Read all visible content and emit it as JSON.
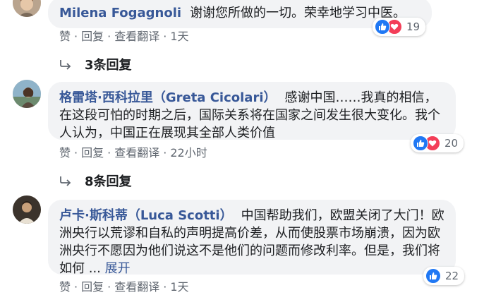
{
  "labels": {
    "like": "赞",
    "reply": "回复",
    "translate": "查看翻译",
    "separator": "·",
    "see_more": "展开"
  },
  "comments": [
    {
      "author": "Milena Fogagnoli",
      "text": "谢谢您所做的一切。荣幸地学习中医。",
      "time": "1天",
      "reactions": {
        "count": "19",
        "types": [
          "like-icon",
          "love-icon"
        ]
      },
      "replies_label": "3条回复"
    },
    {
      "author": "格雷塔·西科拉里（Greta Cicolari）",
      "text": "感谢中国……我真的相信，在这段可怕的时期之后，国际关系将在国家之间发生很大变化。我个人认为，中国正在展现其全部人类价值",
      "time": "22小时",
      "reactions": {
        "count": "20",
        "types": [
          "like-icon",
          "love-icon"
        ]
      },
      "replies_label": "8条回复"
    },
    {
      "author": "卢卡·斯科蒂（Luca Scotti）",
      "text": "中国帮助我们，欧盟关闭了大门！欧洲央行以荒谬和自私的声明提高价差，从而使股票市场崩溃，因为欧洲央行不愿因为他们说这不是他们的问题而修改利率。但是，我们将如何 ...",
      "time": "1天",
      "reactions": {
        "count": "22",
        "types": [
          "like-icon"
        ]
      }
    }
  ],
  "colors": {
    "author_link": "#385898",
    "bubble_bg": "#f2f3f5",
    "meta_text": "#606770",
    "like_blue": "#2078f4",
    "love_red": "#f33e58"
  }
}
